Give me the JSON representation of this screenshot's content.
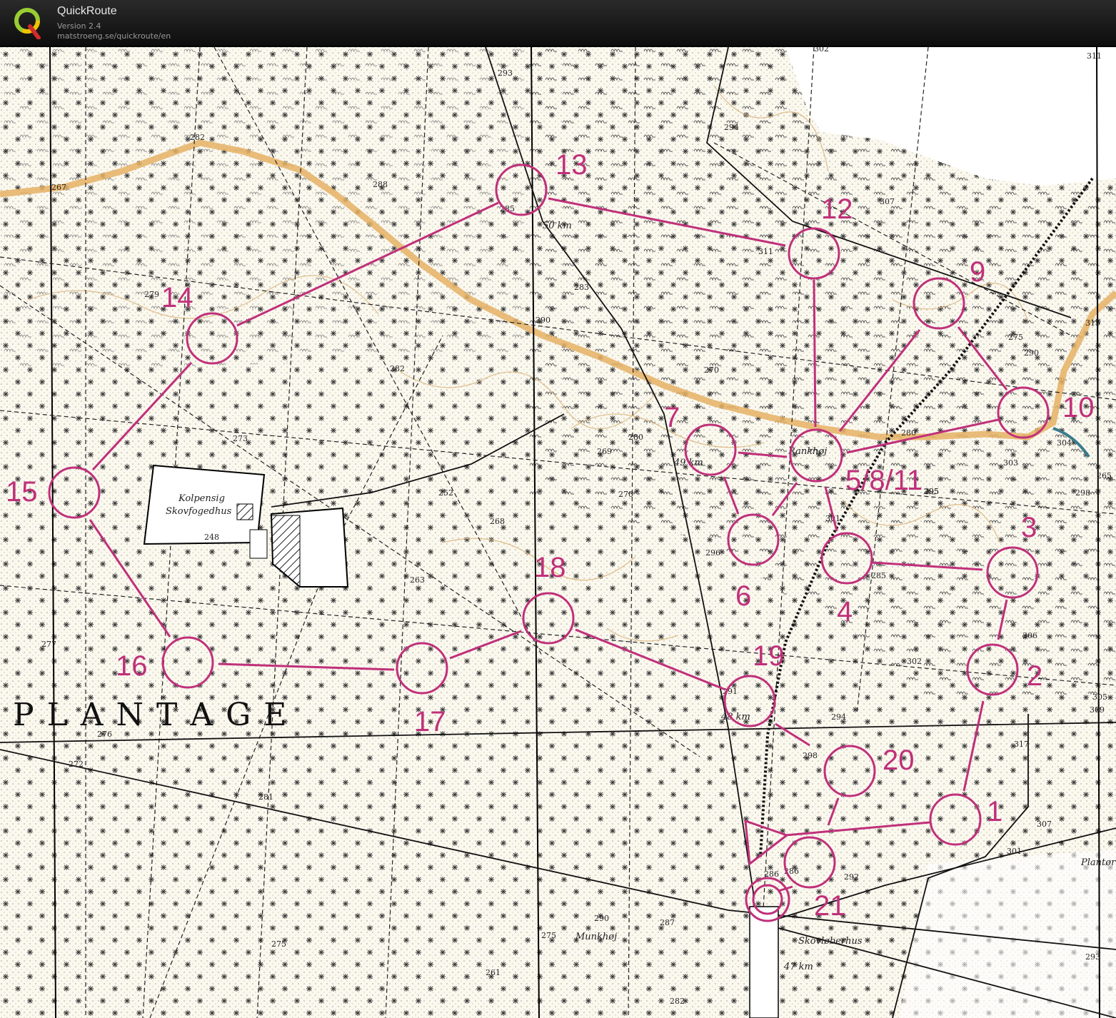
{
  "app": {
    "name": "QuickRoute",
    "version": "Version 2.4",
    "url": "matstroeng.se/quickroute/en"
  },
  "map": {
    "region_label": "P L A N T A G E",
    "place_names": [
      "Kolpensig",
      "Skovfogedhus",
      "Rankhøj",
      "Munkhøj",
      "Skovløberhus",
      "Plantør"
    ],
    "distance_labels": [
      "50 km",
      "49 km",
      "48 km",
      "47 km"
    ],
    "spot_heights": [
      "267",
      "282",
      "288",
      "293",
      "302",
      "311",
      "294",
      "307",
      "285",
      "311",
      "279",
      "283",
      "290",
      "282",
      "270",
      "273",
      "252",
      "248",
      "268",
      "263",
      "276",
      "277",
      "272",
      "275",
      "270",
      "286",
      "280",
      "295",
      "301",
      "285",
      "303",
      "306",
      "302",
      "298",
      "294",
      "291",
      "317",
      "307",
      "301",
      "292",
      "286",
      "287",
      "290",
      "275",
      "261",
      "281",
      "282",
      "280",
      "269",
      "295",
      "293",
      "313",
      "275",
      "290",
      "304",
      "265",
      "298",
      "305",
      "309",
      "296"
    ]
  },
  "course": {
    "color": "#c0307a",
    "start": {
      "type": "triangle"
    },
    "finish": {
      "type": "double-circle"
    },
    "controls": [
      {
        "number": "1"
      },
      {
        "number": "2"
      },
      {
        "number": "3"
      },
      {
        "number": "4"
      },
      {
        "number": "5/8/11"
      },
      {
        "number": "6"
      },
      {
        "number": "7"
      },
      {
        "number": "9"
      },
      {
        "number": "10"
      },
      {
        "number": "12"
      },
      {
        "number": "13"
      },
      {
        "number": "14"
      },
      {
        "number": "15"
      },
      {
        "number": "16"
      },
      {
        "number": "17"
      },
      {
        "number": "18"
      },
      {
        "number": "19"
      },
      {
        "number": "20"
      },
      {
        "number": "21"
      }
    ]
  }
}
